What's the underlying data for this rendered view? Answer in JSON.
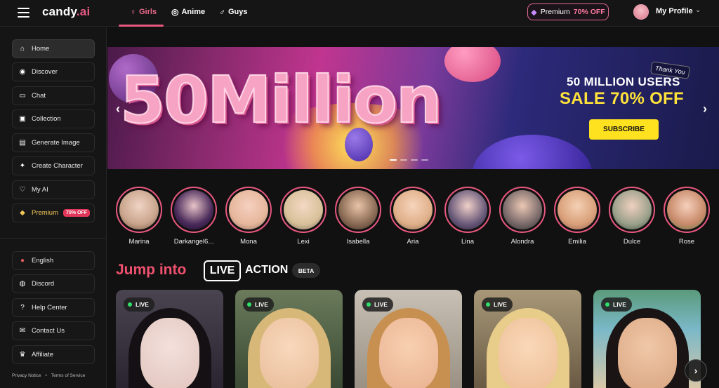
{
  "header": {
    "logo_main": "candy",
    "logo_tld": ".ai",
    "tabs": [
      {
        "label": "Girls",
        "icon": "female-icon"
      },
      {
        "label": "Anime",
        "icon": "anime-icon"
      },
      {
        "label": "Guys",
        "icon": "male-icon"
      }
    ],
    "premium_label": "Premium",
    "premium_off": "70% OFF",
    "profile_label": "My Profile"
  },
  "sidebar": {
    "items": [
      {
        "label": "Home",
        "icon": "home-icon"
      },
      {
        "label": "Discover",
        "icon": "compass-icon"
      },
      {
        "label": "Chat",
        "icon": "chat-icon"
      },
      {
        "label": "Collection",
        "icon": "collection-icon"
      },
      {
        "label": "Generate Image",
        "icon": "image-icon"
      },
      {
        "label": "Create Character",
        "icon": "magic-wand-icon"
      },
      {
        "label": "My AI",
        "icon": "heart-icon"
      },
      {
        "label": "Premium",
        "icon": "diamond-icon",
        "badge": "70% OFF"
      }
    ],
    "bottom_items": [
      {
        "label": "English",
        "icon": "flag-icon"
      },
      {
        "label": "Discord",
        "icon": "discord-icon"
      },
      {
        "label": "Help Center",
        "icon": "help-icon"
      },
      {
        "label": "Contact Us",
        "icon": "mail-icon"
      },
      {
        "label": "Affiliate",
        "icon": "trophy-icon"
      }
    ],
    "privacy": "Privacy Notice",
    "terms": "Terms of Service"
  },
  "banner": {
    "big_text": "50Million",
    "thank_you": "Thank You",
    "headline": "50 MILLION USERS",
    "sale": "SALE 70% OFF",
    "cta": "SUBSCRIBE"
  },
  "characters": [
    {
      "name": "Marina",
      "color": "#c9a48c"
    },
    {
      "name": "Darkangel6...",
      "color": "#4a2a5a"
    },
    {
      "name": "Mona",
      "color": "#e6b79c"
    },
    {
      "name": "Lexi",
      "color": "#d8c19a"
    },
    {
      "name": "Isabella",
      "color": "#8a6a54"
    },
    {
      "name": "Aria",
      "color": "#e0b08a"
    },
    {
      "name": "Lina",
      "color": "#6a5a7a"
    },
    {
      "name": "Alondra",
      "color": "#7a6a6a"
    },
    {
      "name": "Emilia",
      "color": "#d9a07a"
    },
    {
      "name": "Dulce",
      "color": "#9aa08a"
    },
    {
      "name": "Rose",
      "color": "#c88a6a"
    }
  ],
  "live_section": {
    "jump": "Jump into",
    "live": "LIVE",
    "action": "ACTION",
    "beta": "BETA",
    "tag": "LIVE"
  },
  "live_cards": [
    {
      "bg": "#3a3440",
      "hair": "#141014",
      "skin": "#e8cfc8"
    },
    {
      "bg": "#5a6a4a",
      "hair": "#d8b878",
      "skin": "#f0c8a8"
    },
    {
      "bg": "#b8b0a4",
      "hair": "#c89050",
      "skin": "#f0c0a0"
    },
    {
      "bg": "#9a8870",
      "hair": "#e8cc8a",
      "skin": "#f2c8a4"
    },
    {
      "bg": "#6aa0b0",
      "hair": "#1a1414",
      "skin": "#e0b090"
    }
  ]
}
